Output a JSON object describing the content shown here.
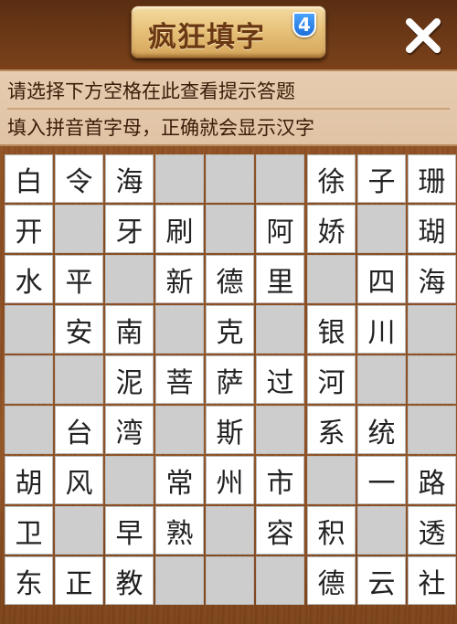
{
  "header": {
    "title": "疯狂填字",
    "badge": "4",
    "close_icon": "close-icon"
  },
  "hints": {
    "line1": "请选择下方空格在此查看提示答题",
    "line2": "填入拼音首字母，正确就会显示汉字"
  },
  "colors": {
    "wood": "#8b4d1f",
    "panel": "#e4c8aa",
    "cell_filled": "#ffffff",
    "cell_empty": "#cdcdcd",
    "badge": "#2b82e8"
  },
  "grid": {
    "rows": [
      [
        "白",
        "令",
        "海",
        "",
        "",
        "",
        "徐",
        "子",
        "珊"
      ],
      [
        "开",
        "",
        "牙",
        "刷",
        "",
        "阿",
        "娇",
        "",
        "瑚"
      ],
      [
        "水",
        "平",
        "",
        "新",
        "德",
        "里",
        "",
        "四",
        "海"
      ],
      [
        "",
        "安",
        "南",
        "",
        "克",
        "",
        "银",
        "川",
        ""
      ],
      [
        "",
        "",
        "泥",
        "菩",
        "萨",
        "过",
        "河",
        "",
        ""
      ],
      [
        "",
        "台",
        "湾",
        "",
        "斯",
        "",
        "系",
        "统",
        ""
      ],
      [
        "胡",
        "风",
        "",
        "常",
        "州",
        "市",
        "",
        "一",
        "路"
      ],
      [
        "卫",
        "",
        "早",
        "熟",
        "",
        "容",
        "积",
        "",
        "透"
      ],
      [
        "东",
        "正",
        "教",
        "",
        "",
        "",
        "德",
        "云",
        "社"
      ]
    ]
  }
}
